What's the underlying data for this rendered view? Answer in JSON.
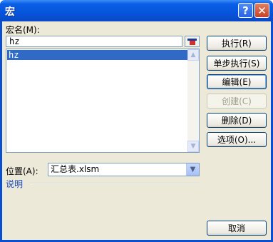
{
  "window": {
    "title": "宏"
  },
  "titlebar": {
    "help_glyph": "?",
    "close_glyph": "✕"
  },
  "macro_name": {
    "label": "宏名(M):",
    "value": "hz"
  },
  "macro_list": {
    "items": [
      "hz"
    ]
  },
  "buttons": {
    "run": "执行(R)",
    "step_into": "单步执行(S)",
    "edit": "编辑(E)",
    "create": "创建(C)",
    "delete": "删除(D)",
    "options": "选项(O)...",
    "cancel": "取消"
  },
  "location": {
    "label": "位置(A):",
    "value": "汇总表.xlsm"
  },
  "description": {
    "label": "说明"
  },
  "icons": {
    "scroll_up": "▲",
    "scroll_down": "▼",
    "dropdown": "▼"
  }
}
